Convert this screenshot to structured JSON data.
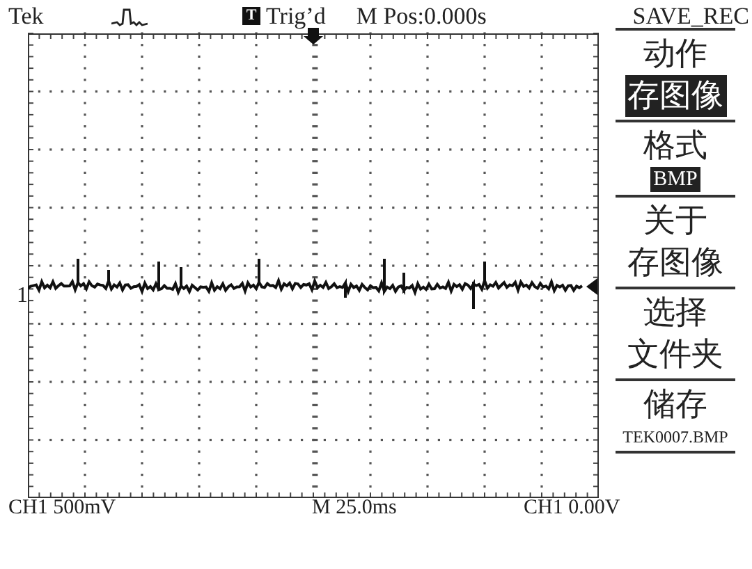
{
  "header": {
    "brand": "Tek",
    "trigger_badge": "T",
    "trigger_status": "Trig’d",
    "position": "M Pos:0.000s"
  },
  "channel_marker": "1",
  "menu": {
    "title": "SAVE_REC",
    "items": [
      {
        "kind": "option",
        "label": "动作",
        "value": "存图像",
        "inverted": true
      },
      {
        "kind": "option",
        "label": "格式",
        "value": "BMP",
        "inverted": true
      },
      {
        "kind": "action",
        "lines": [
          "关于",
          "存图像"
        ]
      },
      {
        "kind": "action",
        "lines": [
          "选择",
          "文件夹"
        ]
      },
      {
        "kind": "option",
        "label": "储存",
        "value": "TEK0007.BMP",
        "inverted": false
      }
    ]
  },
  "footer": {
    "volts_per_div": "CH1 500mV",
    "time_per_div": "M 25.0ms",
    "trigger_level": "CH1 0.00V"
  }
}
